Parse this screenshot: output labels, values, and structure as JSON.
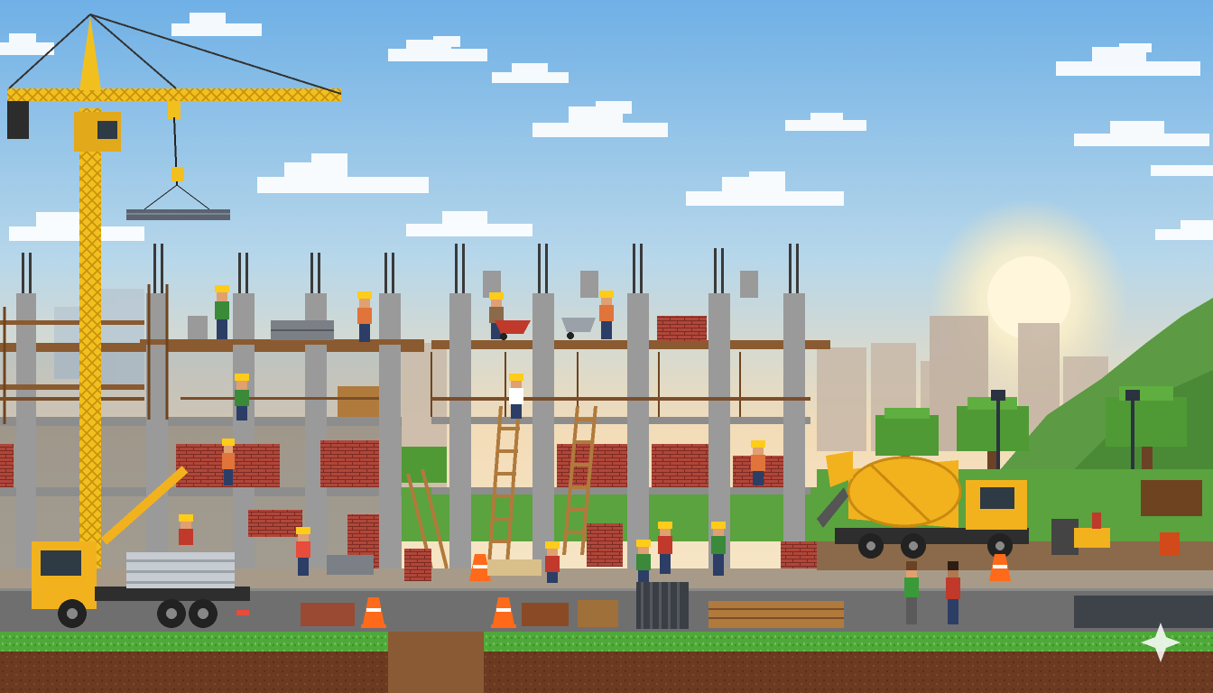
{
  "scene": {
    "palette": {
      "sky_top": "#6fb0e6",
      "sky_mid": "#b7d7ea",
      "sky_horizon": "#f3dcb8",
      "sun": "#fff6dc",
      "crane": "#f2c01e",
      "concrete": "#9a9a9a",
      "brick": "#b0463a",
      "grass": "#4fa83a",
      "soil": "#6b3a21",
      "road": "#6f6f6f",
      "truck": "#f2b21e",
      "cone": "#ff6a1a",
      "helmet": "#ffcc1a"
    }
  }
}
